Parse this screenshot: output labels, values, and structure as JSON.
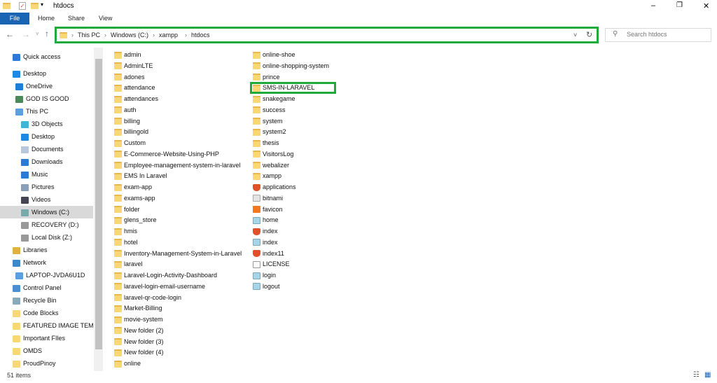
{
  "window": {
    "title": "htdocs",
    "controls": [
      "–",
      "❐",
      "✕"
    ]
  },
  "ribbon": {
    "tabs": [
      "File",
      "Home",
      "Share",
      "View"
    ]
  },
  "address": {
    "crumbs": [
      "This PC",
      "Windows (C:)",
      "xampp",
      "htdocs"
    ]
  },
  "search": {
    "placeholder": "Search htdocs"
  },
  "nav": [
    {
      "label": "Quick access",
      "icon": "star-icon",
      "color": "#2b7bd6",
      "indent": 0
    },
    {
      "label": "Desktop",
      "icon": "desktop-icon",
      "color": "#1e88e5",
      "indent": 0
    },
    {
      "label": "OneDrive",
      "icon": "cloud-icon",
      "color": "#1e7fd8",
      "indent": 1
    },
    {
      "label": "GOD IS GOOD",
      "icon": "user-icon",
      "color": "#4a8a5a",
      "indent": 1
    },
    {
      "label": "This PC",
      "icon": "computer-icon",
      "color": "#5aa0e0",
      "indent": 1
    },
    {
      "label": "3D Objects",
      "icon": "cube-icon",
      "color": "#3fb6d8",
      "indent": 2
    },
    {
      "label": "Desktop",
      "icon": "desktop-icon",
      "color": "#1e88e5",
      "indent": 2
    },
    {
      "label": "Documents",
      "icon": "document-icon",
      "color": "#b8c8dc",
      "indent": 2
    },
    {
      "label": "Downloads",
      "icon": "download-icon",
      "color": "#2b7bd6",
      "indent": 2
    },
    {
      "label": "Music",
      "icon": "music-icon",
      "color": "#2b7bd6",
      "indent": 2
    },
    {
      "label": "Pictures",
      "icon": "pictures-icon",
      "color": "#8aa0b8",
      "indent": 2
    },
    {
      "label": "Videos",
      "icon": "videos-icon",
      "color": "#445",
      "indent": 2
    },
    {
      "label": "Windows (C:)",
      "icon": "drive-icon",
      "color": "#7aa",
      "indent": 2,
      "selected": true
    },
    {
      "label": "RECOVERY (D:)",
      "icon": "drive-icon",
      "color": "#999",
      "indent": 2
    },
    {
      "label": "Local Disk (Z:)",
      "icon": "drive-icon",
      "color": "#999",
      "indent": 2
    },
    {
      "label": "Libraries",
      "icon": "libraries-icon",
      "color": "#e0b040",
      "indent": 0
    },
    {
      "label": "Network",
      "icon": "network-icon",
      "color": "#3a8ad0",
      "indent": 0
    },
    {
      "label": "LAPTOP-JVDA6U1D",
      "icon": "computer-icon",
      "color": "#5aa0e0",
      "indent": 1
    },
    {
      "label": "Control Panel",
      "icon": "control-panel-icon",
      "color": "#4a90d0",
      "indent": 0
    },
    {
      "label": "Recycle Bin",
      "icon": "recycle-bin-icon",
      "color": "#8ab",
      "indent": 0
    },
    {
      "label": "Code Blocks",
      "icon": "folder-icon",
      "color": "#f8d775",
      "indent": 0
    },
    {
      "label": "FEATURED IMAGE TEMP",
      "icon": "folder-icon",
      "color": "#f8d775",
      "indent": 0
    },
    {
      "label": "Important FIles",
      "icon": "folder-icon",
      "color": "#f8d775",
      "indent": 0
    },
    {
      "label": "OMDS",
      "icon": "folder-icon",
      "color": "#f8d775",
      "indent": 0
    },
    {
      "label": "ProudPinoy",
      "icon": "folder-icon",
      "color": "#f8d775",
      "indent": 0
    }
  ],
  "files_col1": [
    "admin",
    "AdminLTE",
    "adones",
    "attendance",
    "attendances",
    "auth",
    "billing",
    "billingold",
    "Custom",
    "E-Commerce-Website-Using-PHP",
    "Employee-management-system-in-laravel",
    "EMS In Laravel",
    "exam-app",
    "exams-app",
    "folder",
    "glens_store",
    "hmis",
    "hotel",
    "Inventory-Management-System-in-Laravel",
    "laravel",
    "Laravel-Login-Activity-Dashboard",
    "laravel-login-email-username",
    "laravel-qr-code-login",
    "Market-Billing",
    "movie-system",
    "New folder (2)",
    "New folder (3)",
    "New folder (4)",
    "online"
  ],
  "files_col2": [
    {
      "name": "online-shoe",
      "icon": "folder-icon"
    },
    {
      "name": "online-shopping-system",
      "icon": "folder-icon"
    },
    {
      "name": "prince",
      "icon": "folder-icon"
    },
    {
      "name": "SMS-IN-LARAVEL",
      "icon": "folder-icon",
      "highlighted": true
    },
    {
      "name": "snakegame",
      "icon": "folder-icon"
    },
    {
      "name": "success",
      "icon": "folder-icon"
    },
    {
      "name": "system",
      "icon": "folder-icon"
    },
    {
      "name": "system2",
      "icon": "folder-icon"
    },
    {
      "name": "thesis",
      "icon": "folder-icon"
    },
    {
      "name": "VisitorsLog",
      "icon": "folder-icon"
    },
    {
      "name": "webalizer",
      "icon": "folder-icon"
    },
    {
      "name": "xampp",
      "icon": "folder-icon"
    },
    {
      "name": "applications",
      "icon": "brave-browser-icon"
    },
    {
      "name": "bitnami",
      "icon": "css-file-icon"
    },
    {
      "name": "favicon",
      "icon": "xampp-icon"
    },
    {
      "name": "home",
      "icon": "php-file-icon"
    },
    {
      "name": "index",
      "icon": "brave-browser-icon"
    },
    {
      "name": "index",
      "icon": "php-file-icon"
    },
    {
      "name": "index11",
      "icon": "brave-browser-icon"
    },
    {
      "name": "LICENSE",
      "icon": "file-icon"
    },
    {
      "name": "login",
      "icon": "php-file-icon"
    },
    {
      "name": "logout",
      "icon": "php-file-icon"
    }
  ],
  "status": {
    "count": "51 items"
  },
  "colors": {
    "highlight": "#1faa3a",
    "file_tab": "#1a64b4"
  }
}
